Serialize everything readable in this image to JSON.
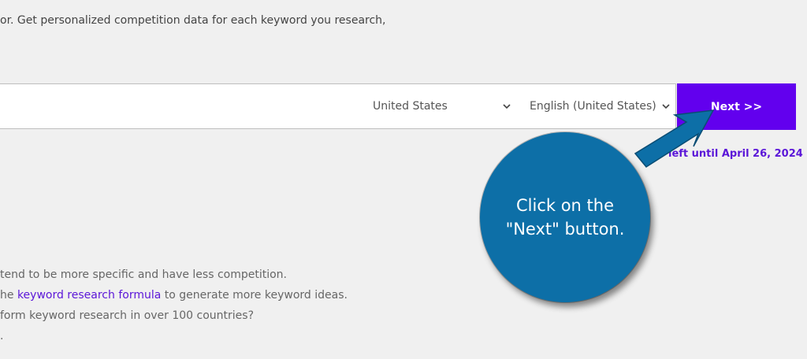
{
  "intro_text": "or. Get personalized competition data for each keyword you research,",
  "search": {
    "country": "United States",
    "language": "English (United States)",
    "next_label": "Next >>"
  },
  "quota_text": "left until April 26, 2024",
  "tips": {
    "line1": "tend to be more specific and have less competition.",
    "line2_prefix": "he ",
    "line2_link": "keyword research formula",
    "line2_suffix": " to generate more keyword ideas.",
    "line3": "form keyword research in over 100 countries?",
    "line4": "."
  },
  "callout": {
    "text": "Click on the \"Next\" button.",
    "color": "#0d6fa7"
  },
  "colors": {
    "accent": "#6200ee",
    "link": "#5b16d8"
  }
}
